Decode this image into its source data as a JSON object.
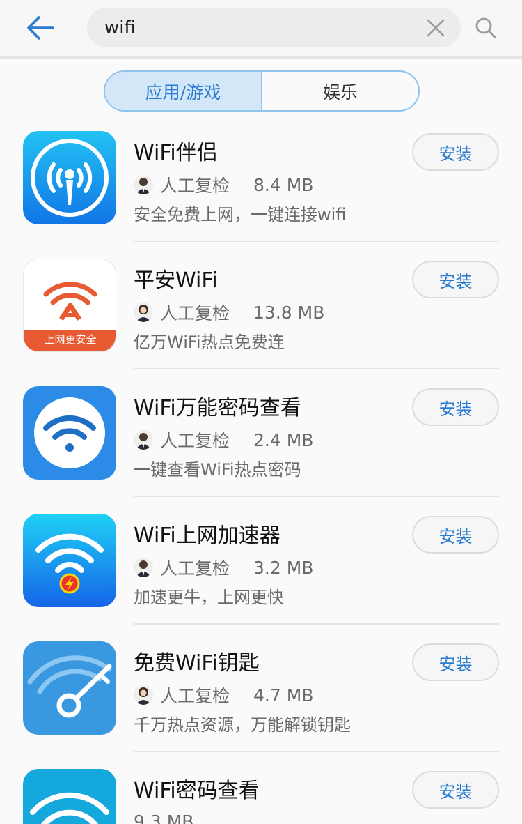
{
  "search": {
    "query": "wifi"
  },
  "tabs": [
    {
      "label": "应用/游戏",
      "active": true
    },
    {
      "label": "娱乐",
      "active": false
    }
  ],
  "colors": {
    "accent": "#2a7cd2",
    "tab_active_bg": "#d3e7f8"
  },
  "apps": [
    {
      "name": "WiFi伴侣",
      "reviewer": "人工复检",
      "size": "8.4 MB",
      "desc": "安全免费上网，一键连接wifi",
      "install": "安装",
      "icon": "wifi-tower-icon"
    },
    {
      "name": "平安WiFi",
      "reviewer": "人工复检",
      "size": "13.8 MB",
      "desc": "亿万WiFi热点免费连",
      "install": "安装",
      "icon": "ping-an-wifi-icon",
      "icon_text": "上网更安全"
    },
    {
      "name": "WiFi万能密码查看",
      "reviewer": "人工复检",
      "size": "2.4 MB",
      "desc": "一键查看WiFi热点密码",
      "install": "安装",
      "icon": "wifi-circle-icon"
    },
    {
      "name": "WiFi上网加速器",
      "reviewer": "人工复检",
      "size": "3.2 MB",
      "desc": "加速更牛，上网更快",
      "install": "安装",
      "icon": "wifi-lightning-icon"
    },
    {
      "name": "免费WiFi钥匙",
      "reviewer": "人工复检",
      "size": "4.7 MB",
      "desc": "千万热点资源，万能解锁钥匙",
      "install": "安装",
      "icon": "wifi-key-icon"
    },
    {
      "name": "WiFi密码查看",
      "reviewer": "",
      "size": "9.3 MB",
      "desc": "",
      "install": "安装",
      "icon": "wifi-waves-icon"
    }
  ]
}
